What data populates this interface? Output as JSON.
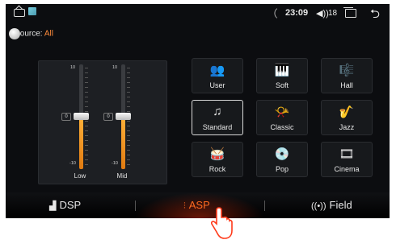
{
  "status": {
    "time": "23:09",
    "volume_icon": "◀))",
    "volume_value": "18",
    "back_glyph": "⮌"
  },
  "source": {
    "label": "ource:",
    "value": "All"
  },
  "equalizer": {
    "sliders": [
      {
        "label": "Low",
        "top_value": "10",
        "bottom_value": "-10",
        "current": "0",
        "level_fraction": 0.5
      },
      {
        "label": "Mid",
        "top_value": "10",
        "bottom_value": "-10",
        "current": "0",
        "level_fraction": 0.5
      }
    ]
  },
  "presets": [
    {
      "label": "User",
      "icon": "user-group-icon",
      "glyph": "👥",
      "selected": false
    },
    {
      "label": "Soft",
      "icon": "piano-icon",
      "glyph": "🎹",
      "selected": false
    },
    {
      "label": "Hall",
      "icon": "hall-icon",
      "glyph": "🎼",
      "selected": false
    },
    {
      "label": "Standard",
      "icon": "music-note-icon",
      "glyph": "♫",
      "selected": true
    },
    {
      "label": "Classic",
      "icon": "gramophone-icon",
      "glyph": "📯",
      "selected": false
    },
    {
      "label": "Jazz",
      "icon": "saxophone-icon",
      "glyph": "🎷",
      "selected": false
    },
    {
      "label": "Rock",
      "icon": "drum-icon",
      "glyph": "🥁",
      "selected": false
    },
    {
      "label": "Pop",
      "icon": "disc-icon",
      "glyph": "💿",
      "selected": false
    },
    {
      "label": "Cinema",
      "icon": "cinema-icon",
      "glyph": "🎞",
      "selected": false
    }
  ],
  "tabs": {
    "dsp": {
      "label": "DSP",
      "glyph": "▟"
    },
    "asp": {
      "label": "ASP",
      "glyph": "⫶"
    },
    "field": {
      "label": "Field",
      "glyph": "((•))"
    }
  },
  "colors": {
    "accent": "#ff6a20",
    "slider_fill": "#f0951f",
    "source_value": "#ff8b3a"
  }
}
